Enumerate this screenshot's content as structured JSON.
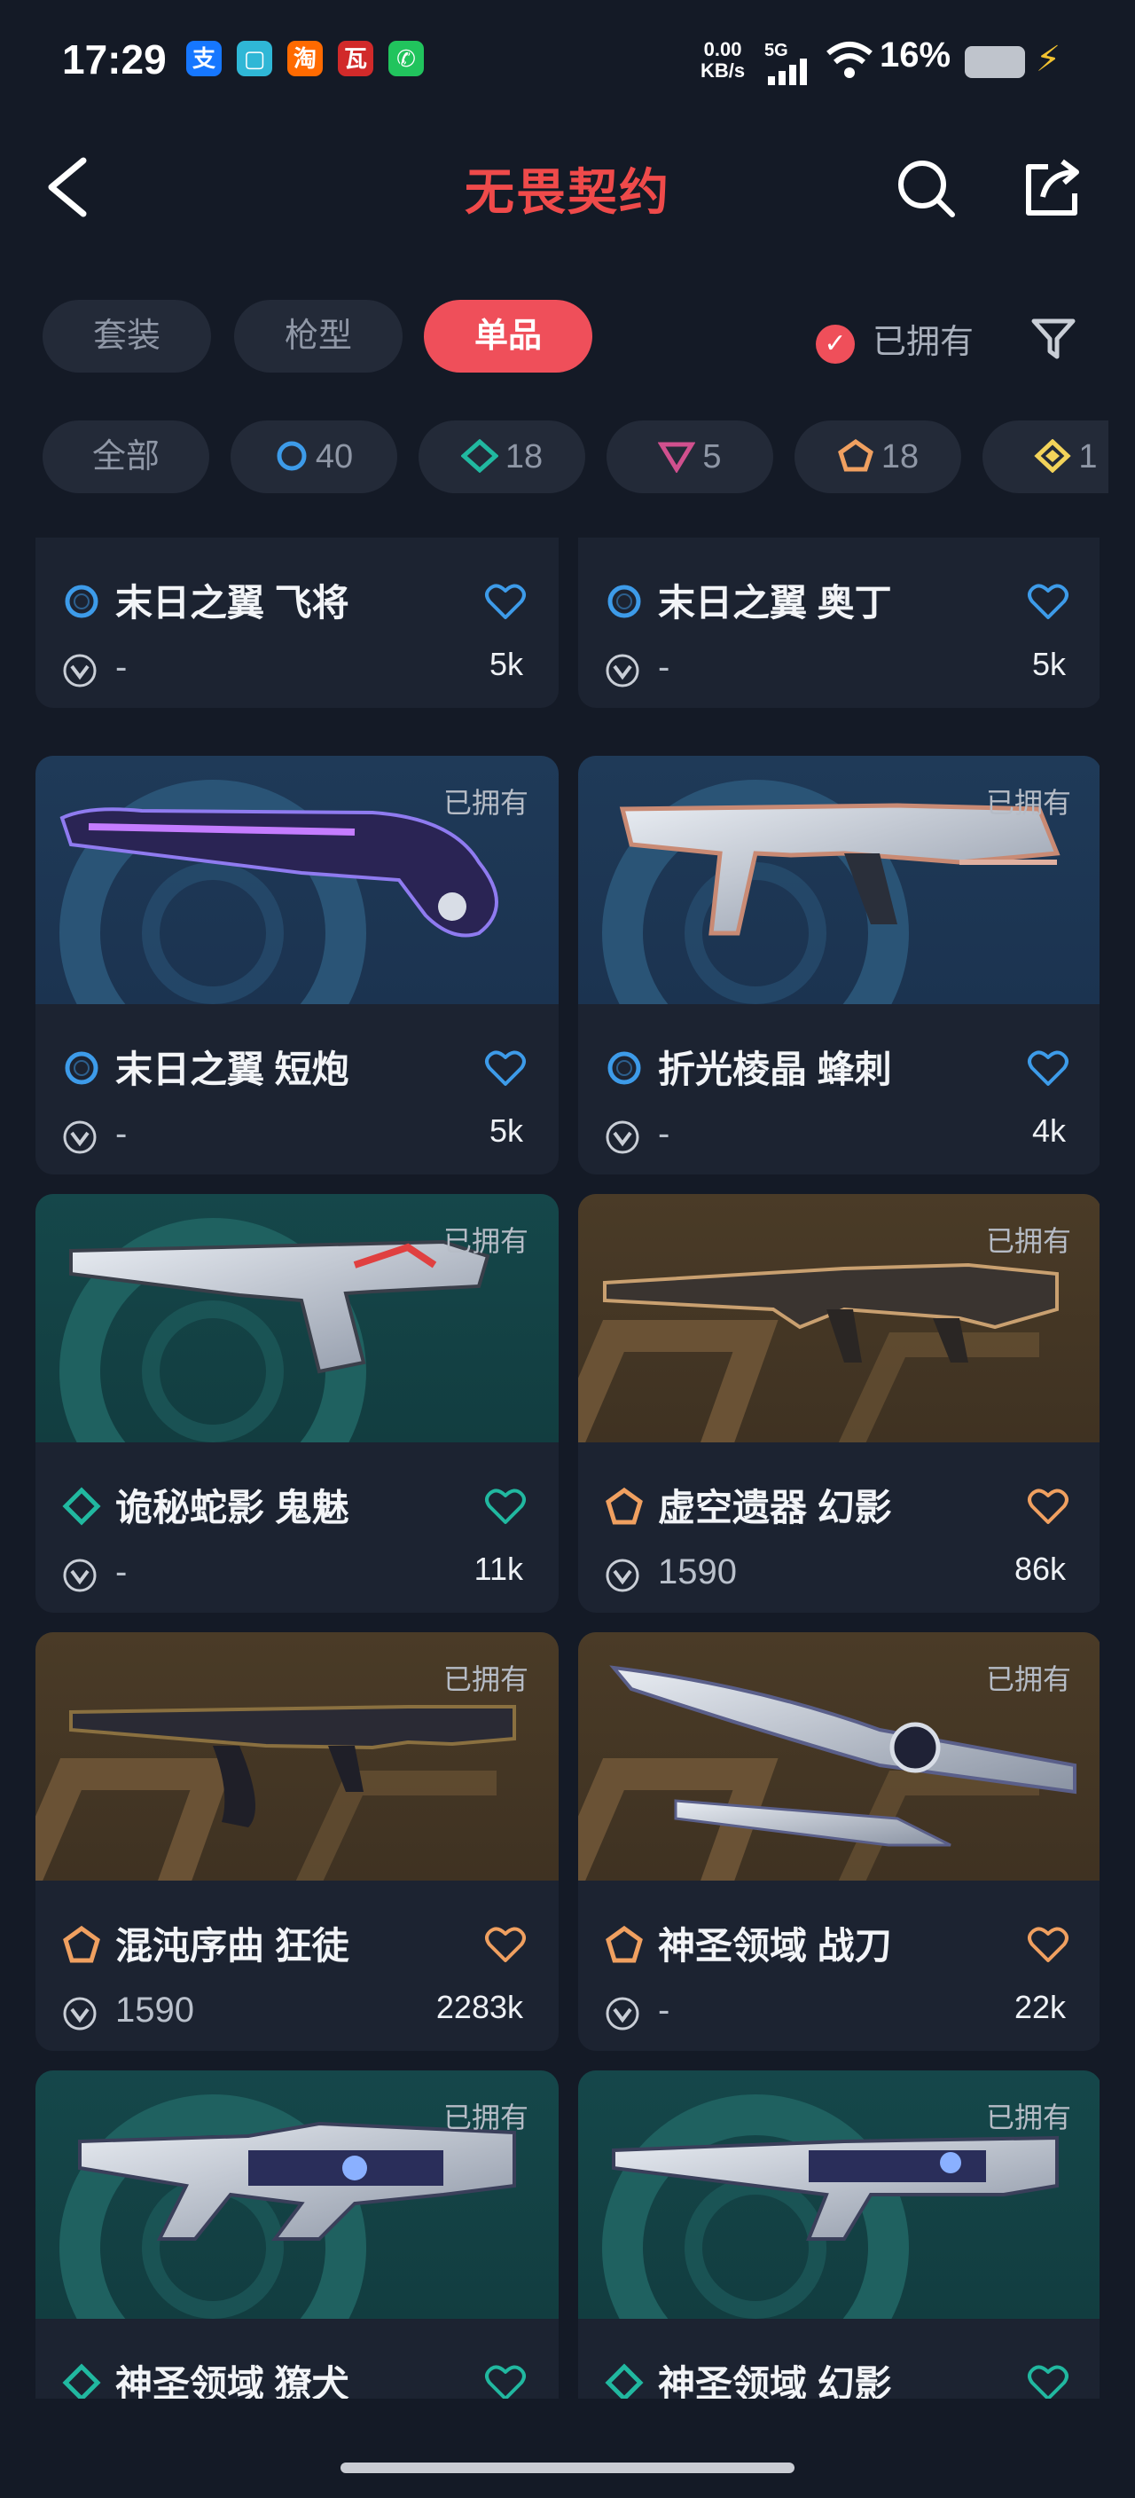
{
  "status_bar": {
    "time": "17:29",
    "app_icons": [
      {
        "name": "alipay-icon",
        "glyph": "支",
        "color": "#1677ff"
      },
      {
        "name": "notes-app-icon",
        "glyph": "▢",
        "color": "#2fb7d6"
      },
      {
        "name": "taobao-icon",
        "glyph": "淘",
        "color": "#ff6a00"
      },
      {
        "name": "game-app-icon",
        "glyph": "瓦",
        "color": "#d12a2a"
      },
      {
        "name": "call-app-icon",
        "glyph": "✆",
        "color": "#21c45d"
      }
    ],
    "net_speed": "0.00",
    "net_unit": "KB/s",
    "signal": "5G",
    "battery": "16%"
  },
  "header": {
    "title": "无畏契约"
  },
  "tabs": [
    {
      "label": "套装",
      "active": false
    },
    {
      "label": "枪型",
      "active": false
    },
    {
      "label": "单品",
      "active": true
    }
  ],
  "owned_filter_label": "已拥有",
  "rarity_chips": [
    {
      "label": "全部",
      "tier": "all"
    },
    {
      "label": "40",
      "tier": "select",
      "color": "#3d9be9"
    },
    {
      "label": "18",
      "tier": "deluxe",
      "color": "#21b8a0"
    },
    {
      "label": "5",
      "tier": "premium",
      "color": "#d0508e"
    },
    {
      "label": "18",
      "tier": "exclusive",
      "color": "#f0a060"
    },
    {
      "label": "1",
      "tier": "ultra",
      "color": "#f2d35a"
    }
  ],
  "cards": [
    {
      "name": "末日之翼 飞将",
      "tier": "select",
      "tier_color": "#3d9be9",
      "price": "-",
      "likes": "5k",
      "owned": false,
      "bg": "blue",
      "weapon": "none"
    },
    {
      "name": "末日之翼 奥丁",
      "tier": "select",
      "tier_color": "#3d9be9",
      "price": "-",
      "likes": "5k",
      "owned": false,
      "bg": "blue",
      "weapon": "none"
    },
    {
      "name": "末日之翼 短炮",
      "tier": "select",
      "tier_color": "#3d9be9",
      "price": "-",
      "likes": "5k",
      "owned": true,
      "bg": "blue",
      "weapon": "shotgun"
    },
    {
      "name": "折光棱晶 蜂刺",
      "tier": "select",
      "tier_color": "#3d9be9",
      "price": "-",
      "likes": "4k",
      "owned": true,
      "bg": "blue",
      "weapon": "smg"
    },
    {
      "name": "诡秘蛇影 鬼魅",
      "tier": "deluxe",
      "tier_color": "#21b8a0",
      "price": "-",
      "likes": "11k",
      "owned": true,
      "bg": "teal",
      "weapon": "pistol"
    },
    {
      "name": "虚空遗器 幻影",
      "tier": "exclusive",
      "tier_color": "#f0a060",
      "price": "1590",
      "likes": "86k",
      "owned": true,
      "bg": "gold",
      "weapon": "rifle"
    },
    {
      "name": "混沌序曲 狂徒",
      "tier": "exclusive",
      "tier_color": "#f0a060",
      "price": "1590",
      "likes": "2283k",
      "owned": true,
      "bg": "gold",
      "weapon": "ak"
    },
    {
      "name": "神圣领域 战刀",
      "tier": "exclusive",
      "tier_color": "#f0a060",
      "price": "-",
      "likes": "22k",
      "owned": true,
      "bg": "gold",
      "weapon": "knife"
    },
    {
      "name": "神圣领域 獠犬",
      "tier": "deluxe",
      "tier_color": "#21b8a0",
      "price": "",
      "likes": "",
      "owned": true,
      "bg": "teal",
      "weapon": "bullpup"
    },
    {
      "name": "神圣领域 幻影",
      "tier": "deluxe",
      "tier_color": "#21b8a0",
      "price": "",
      "likes": "",
      "owned": true,
      "bg": "teal",
      "weapon": "rifle2"
    }
  ]
}
